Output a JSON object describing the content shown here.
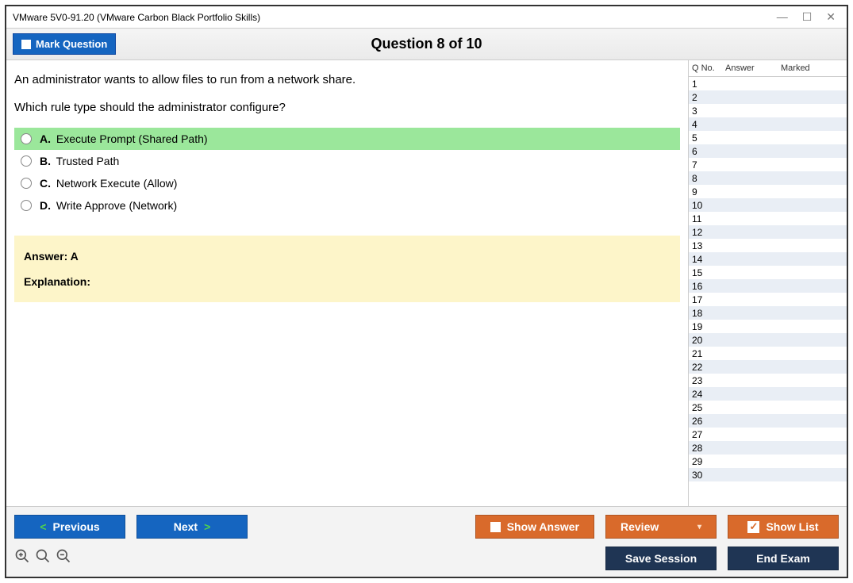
{
  "window": {
    "title": "VMware 5V0-91.20 (VMware Carbon Black Portfolio Skills)"
  },
  "header": {
    "mark_label": "Mark Question",
    "question_title": "Question 8 of 10"
  },
  "question": {
    "line1": "An administrator wants to allow files to run from a network share.",
    "line2": "Which rule type should the administrator configure?",
    "options": [
      {
        "letter": "A.",
        "text": "Execute Prompt (Shared Path)",
        "highlight": true
      },
      {
        "letter": "B.",
        "text": "Trusted Path",
        "highlight": false
      },
      {
        "letter": "C.",
        "text": "Network Execute (Allow)",
        "highlight": false
      },
      {
        "letter": "D.",
        "text": "Write Approve (Network)",
        "highlight": false
      }
    ]
  },
  "answer": {
    "label": "Answer: A",
    "explanation_label": "Explanation:"
  },
  "side": {
    "col1": "Q No.",
    "col2": "Answer",
    "col3": "Marked",
    "rows": [
      "1",
      "2",
      "3",
      "4",
      "5",
      "6",
      "7",
      "8",
      "9",
      "10",
      "11",
      "12",
      "13",
      "14",
      "15",
      "16",
      "17",
      "18",
      "19",
      "20",
      "21",
      "22",
      "23",
      "24",
      "25",
      "26",
      "27",
      "28",
      "29",
      "30"
    ]
  },
  "footer": {
    "previous": "Previous",
    "next": "Next",
    "show_answer": "Show Answer",
    "review": "Review",
    "show_list": "Show List",
    "save_session": "Save Session",
    "end_exam": "End Exam"
  }
}
